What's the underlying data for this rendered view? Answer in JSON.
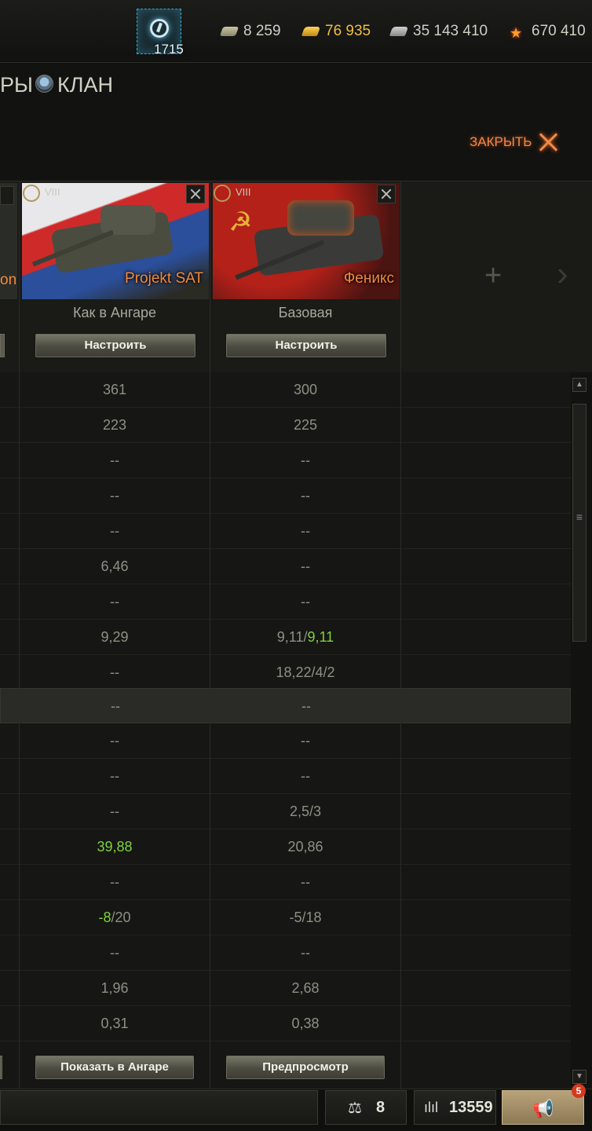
{
  "currencies": {
    "xp": "1715",
    "credits": "8 259",
    "gold": "76 935",
    "free_xp": "35 143 410",
    "crew_xp": "670 410"
  },
  "nav": {
    "prev": "РЫ",
    "clan": "КЛАН"
  },
  "close_label": "ЗАКРЫТЬ",
  "left_partial_name": "on",
  "vehicles": [
    {
      "tier": "VIII",
      "name": "Projekt SAT",
      "config": "Как в Ангаре",
      "configure": "Настроить",
      "action": "Показать в Ангаре"
    },
    {
      "tier": "VIII",
      "name": "Феникс",
      "config": "Базовая",
      "configure": "Настроить",
      "action": "Предпросмотр"
    }
  ],
  "rows": [
    {
      "a": "361",
      "b": "300"
    },
    {
      "a": "223",
      "b": "225"
    },
    {
      "a": "--",
      "b": "--"
    },
    {
      "a": "--",
      "b": "--"
    },
    {
      "a": "--",
      "b": "--"
    },
    {
      "a": "6,46",
      "b": "--"
    },
    {
      "a": "--",
      "b": "--"
    },
    {
      "a": "9,29",
      "b_pre": "9,11/",
      "b_green": "9,11"
    },
    {
      "a": "--",
      "b": "18,22/4/2"
    },
    {
      "a": "--",
      "b": "--"
    },
    {
      "a": "--",
      "b": "--"
    },
    {
      "a": "--",
      "b": "--"
    },
    {
      "a": "--",
      "b": "2,5/3"
    },
    {
      "a_green": "39,88",
      "b": "20,86"
    },
    {
      "a": "--",
      "b": "--"
    },
    {
      "a_green": "-8",
      "a_post": "/20",
      "b": "-5/18"
    },
    {
      "a": "--",
      "b": "--"
    },
    {
      "a": "1,96",
      "b": "2,68"
    },
    {
      "a": "0,31",
      "b": "0,38"
    }
  ],
  "bottom": {
    "balance": "8",
    "stats": "13559",
    "notifications": "5"
  },
  "icons": {
    "credits": "credits-icon",
    "gold": "gold-icon",
    "free_xp": "free-xp-icon",
    "crew_xp": "star-icon"
  },
  "colors": {
    "accent": "#f28a3c",
    "positive": "#7fd23b",
    "xp": "#3aa6c9"
  }
}
